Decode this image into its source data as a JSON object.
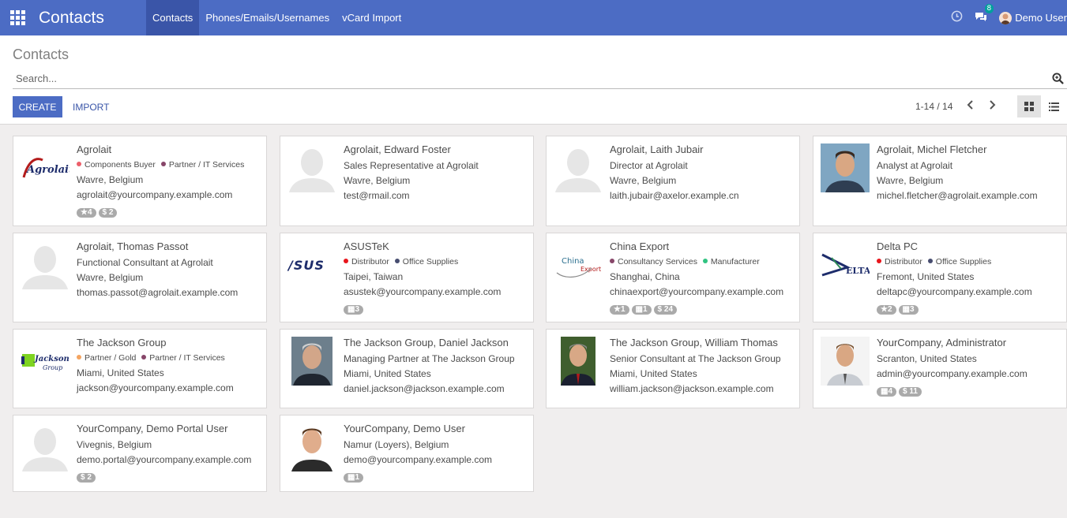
{
  "app": {
    "title": "Contacts"
  },
  "menu": [
    {
      "label": "Contacts"
    },
    {
      "label": "Phones/Emails/Usernames"
    },
    {
      "label": "vCard Import"
    }
  ],
  "systray": {
    "message_count": "8",
    "user_name": "Demo User"
  },
  "breadcrumb": "Contacts",
  "search": {
    "placeholder": "Search..."
  },
  "actions": {
    "create_label": "CREATE",
    "import_label": "IMPORT"
  },
  "pager": {
    "text": "1-14 / 14"
  },
  "colors": {
    "navbar": "#4c6cc4",
    "accent": "#3a55a8",
    "underline": "#e8151b"
  },
  "cards": [
    {
      "name": "Agrolait",
      "tags": [
        {
          "label": "Components Buyer",
          "color": "#ec5f6a"
        },
        {
          "label": "Partner / IT Services",
          "color": "#874669"
        }
      ],
      "lines": [
        "Wavre, Belgium",
        "agrolait@yourcompany.example.com"
      ],
      "badges": [
        "★4",
        "$ 2"
      ]
    },
    {
      "name": "Agrolait, Edward Foster",
      "lines": [
        "Sales Representative at Agrolait",
        "Wavre, Belgium",
        "test@rmail.com"
      ]
    },
    {
      "name": "Agrolait, Laith Jubair",
      "lines": [
        "Director at Agrolait",
        "Wavre, Belgium",
        "laith.jubair@axelor.example.cn"
      ]
    },
    {
      "name": "Agrolait, Michel Fletcher",
      "lines": [
        "Analyst at Agrolait",
        "Wavre, Belgium",
        "michel.fletcher@agrolait.example.com"
      ]
    },
    {
      "name": "Agrolait, Thomas Passot",
      "lines": [
        "Functional Consultant at Agrolait",
        "Wavre, Belgium",
        "thomas.passot@agrolait.example.com"
      ]
    },
    {
      "name": "ASUSTeK",
      "tags": [
        {
          "label": "Distributor",
          "color": "#e8151b"
        },
        {
          "label": "Office Supplies",
          "color": "#474d70"
        }
      ],
      "lines": [
        "Taipei, Taiwan",
        "asustek@yourcompany.example.com"
      ],
      "badges": [
        "▦3"
      ]
    },
    {
      "name": "China Export",
      "tags": [
        {
          "label": "Consultancy Services",
          "color": "#874669"
        },
        {
          "label": "Manufacturer",
          "color": "#30c381"
        }
      ],
      "lines": [
        "Shanghai, China",
        "chinaexport@yourcompany.example.com"
      ],
      "badges": [
        "★1",
        "▦1",
        "$ 24"
      ]
    },
    {
      "name": "Delta PC",
      "tags": [
        {
          "label": "Distributor",
          "color": "#e8151b"
        },
        {
          "label": "Office Supplies",
          "color": "#474d70"
        }
      ],
      "lines": [
        "Fremont, United States",
        "deltapc@yourcompany.example.com"
      ],
      "badges": [
        "★2",
        "▦3"
      ]
    },
    {
      "name": "The Jackson Group",
      "tags": [
        {
          "label": "Partner / Gold",
          "color": "#f4a460"
        },
        {
          "label": "Partner / IT Services",
          "color": "#874669"
        }
      ],
      "lines": [
        "Miami, United States",
        "jackson@yourcompany.example.com"
      ]
    },
    {
      "name": "The Jackson Group, Daniel Jackson",
      "lines": [
        "Managing Partner at The Jackson Group",
        "Miami, United States",
        "daniel.jackson@jackson.example.com"
      ]
    },
    {
      "name": "The Jackson Group, William Thomas",
      "lines": [
        "Senior Consultant at The Jackson Group",
        "Miami, United States",
        "william.jackson@jackson.example.com"
      ]
    },
    {
      "name": "YourCompany, Administrator",
      "lines": [
        "Scranton, United States",
        "admin@yourcompany.example.com"
      ],
      "badges": [
        "▦4",
        "$ 11"
      ]
    },
    {
      "name": "YourCompany, Demo Portal User",
      "lines": [
        "Vivegnis, Belgium",
        "demo.portal@yourcompany.example.com"
      ],
      "badges": [
        "$ 2"
      ]
    },
    {
      "name": "YourCompany, Demo User",
      "lines": [
        "Namur (Loyers), Belgium",
        "demo@yourcompany.example.com"
      ],
      "badges": [
        "▦1"
      ]
    }
  ]
}
